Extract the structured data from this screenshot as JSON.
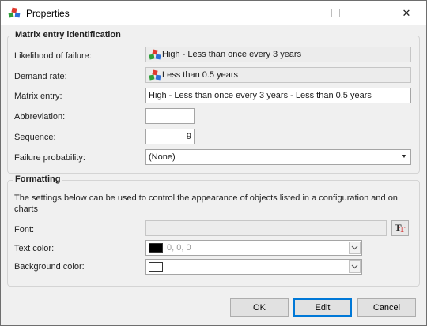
{
  "window": {
    "title": "Properties",
    "icon": "colored-cubes-icon",
    "close_glyph": "✕"
  },
  "identification": {
    "title": "Matrix entry identification",
    "likelihood": {
      "label": "Likelihood of failure:",
      "value": "High - Less than once every 3  years",
      "icon": "colored-cubes-icon"
    },
    "demand_rate": {
      "label": "Demand rate:",
      "value": "Less than 0.5 years",
      "icon": "colored-cubes-icon"
    },
    "matrix_entry": {
      "label": "Matrix entry:",
      "value": "High - Less than once every 3  years - Less than 0.5 years"
    },
    "abbreviation": {
      "label": "Abbreviation:",
      "value": ""
    },
    "sequence": {
      "label": "Sequence:",
      "value": "9"
    },
    "failure_probability": {
      "label": "Failure probability:",
      "value": "(None)",
      "arrow": "▼"
    }
  },
  "formatting": {
    "title": "Formatting",
    "description": "The settings below can be used to control the appearance of objects listed in a configuration and on charts",
    "font": {
      "label": "Font:",
      "value": "",
      "button_icon": "font-color-icon"
    },
    "text_color": {
      "label": "Text color:",
      "value": "0, 0, 0",
      "swatch": "#000000"
    },
    "background_color": {
      "label": "Background color:",
      "value": "",
      "swatch": "#ffffff"
    }
  },
  "buttons": {
    "ok": "OK",
    "edit": "Edit",
    "cancel": "Cancel"
  },
  "colors": {
    "accent": "#0078d7",
    "window_bg": "#f0f0f0",
    "readonly_bg": "#ececec"
  }
}
